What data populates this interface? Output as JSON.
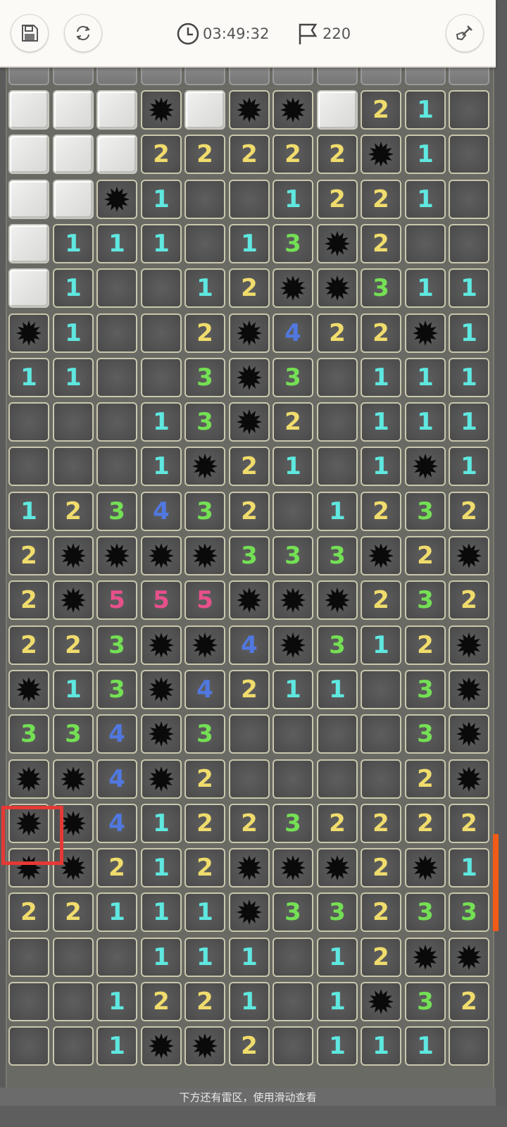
{
  "header": {
    "save_icon": "floppy-disk-icon",
    "restart_icon": "refresh-icon",
    "timer_icon": "clock-icon",
    "timer": "03:49:32",
    "flag_icon": "flag-icon",
    "flags": "220",
    "tool_icon": "shovel-icon"
  },
  "board": {
    "rows": [
      "ooo*o**o21.",
      "ooo22222*1.",
      "oo*1..1221.",
      "o111.13*2..",
      "o1..12**311",
      "*1..2*422*1",
      "11..3*3.111",
      "...13*2.111",
      "...1*21.1*1",
      "123432.1232",
      "2****333*2*",
      "2*555***232",
      "223**4*312*",
      "*13*4211.3*",
      "334*3....3*",
      "**4*2....2*",
      "**41223222 2",
      "**212***2*1",
      "22111*33233",
      "...111.12**",
      "..1221.1*32",
      "..1**2.111."
    ]
  },
  "footer": {
    "hint": "下方还有雷区，使用滑动查看"
  },
  "colors": {
    "n1": "#5ee8e0",
    "n2": "#f0dc6c",
    "n3": "#74e054",
    "n4": "#5078e0",
    "n5": "#e8508c",
    "highlight": "#e53935",
    "scroll_thumb": "#f25b16"
  }
}
